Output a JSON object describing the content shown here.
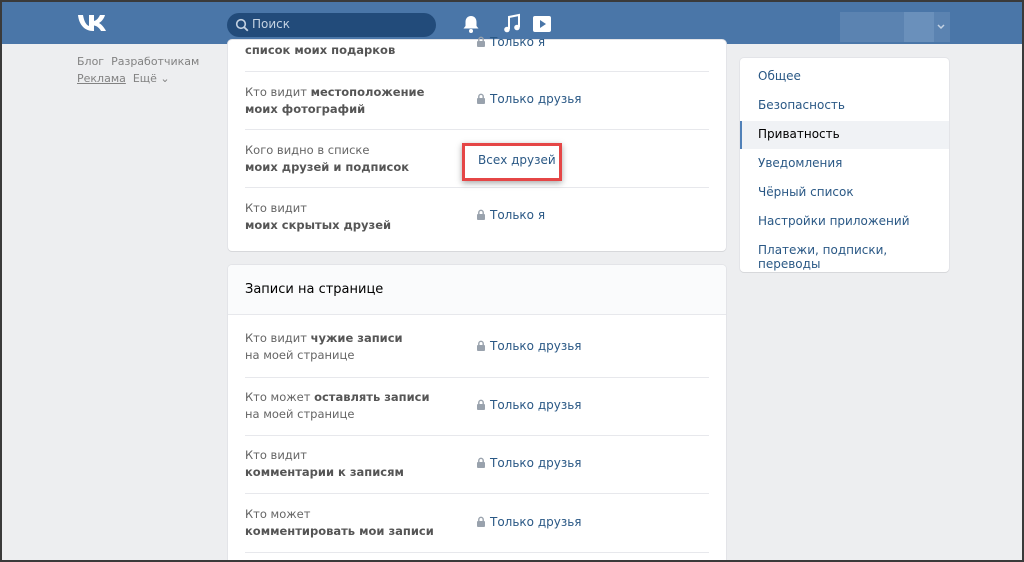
{
  "header": {
    "search_placeholder": "Поиск"
  },
  "leftnav": {
    "items": [
      "Блог",
      "Разработчикам",
      "Реклама",
      "Ещё ⌄"
    ]
  },
  "privacy_section": {
    "rows": [
      {
        "q_normal": "",
        "q_bold": "список моих подарков",
        "value": "Только я",
        "lock": true
      },
      {
        "q_normal": "Кто видит ",
        "q_bold1": "местоположение",
        "q_line2": "моих фотографий",
        "value": "Только друзья",
        "lock": true
      },
      {
        "q_normal": "Кого видно в списке",
        "q_line2": "моих друзей и подписок",
        "value": "Всех друзей",
        "lock": false
      },
      {
        "q_normal": "Кто видит",
        "q_line2": "моих скрытых друзей",
        "value": "Только я",
        "lock": true
      }
    ]
  },
  "wall_section": {
    "title": "Записи на странице",
    "rows": [
      {
        "q_line1_normal": "Кто видит ",
        "q_line1_bold": "чужие записи",
        "q_line2_normal": "на моей странице",
        "q_line2_bold": "",
        "value": "Только друзья"
      },
      {
        "q_line1_normal": "Кто может ",
        "q_line1_bold": "оставлять записи",
        "q_line2_normal": "на моей странице",
        "q_line2_bold": "",
        "value": "Только друзья"
      },
      {
        "q_line1_normal": "Кто видит",
        "q_line1_bold": "",
        "q_line2_normal": "",
        "q_line2_bold": "комментарии к записям",
        "value": "Только друзья"
      },
      {
        "q_line1_normal": "Кто может",
        "q_line1_bold": "",
        "q_line2_normal": "",
        "q_line2_bold": "комментировать мои записи",
        "value": "Только друзья"
      }
    ]
  },
  "right_menu": {
    "items": [
      "Общее",
      "Безопасность",
      "Приватность",
      "Уведомления",
      "Чёрный список",
      "Настройки приложений",
      "Платежи, подписки, переводы"
    ],
    "active_index": 2
  },
  "colors": {
    "header_bg": "#4a76a8",
    "link": "#2a5885",
    "highlight_border": "#e54646"
  }
}
